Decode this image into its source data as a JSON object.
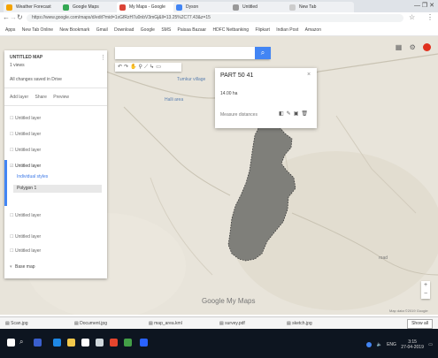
{
  "browser": {
    "tabs": [
      {
        "label": "Weather Forecast"
      },
      {
        "label": "Google Maps"
      },
      {
        "label": "My Maps - Google"
      },
      {
        "label": "Dyson"
      },
      {
        "label": "Untitled"
      },
      {
        "label": "New Tab"
      }
    ],
    "url": "https://www.google.com/maps/d/edit?mid=1xGfRzH7u0nbV3mGj&ll=13.25%2C77.43&z=15",
    "bookmarks": [
      "Apps",
      "New Tab Online",
      "New Bookmark",
      "Gmail",
      "Download",
      "Google",
      "SMS",
      "Paisaa Bazaar",
      "HDFC Netbanking",
      "Flipkart",
      "Indian Post",
      "Amazon"
    ],
    "window_controls": "— ❐ ✕"
  },
  "panel": {
    "title": "UNTITLED MAP",
    "subtitle": "1 views",
    "meta": "All changes saved in Drive",
    "actions": [
      "Add layer",
      "Share",
      "Preview"
    ],
    "layers": [
      {
        "label": "Untitled layer",
        "icon": "layer"
      },
      {
        "label": "Untitled layer",
        "icon": "layer"
      },
      {
        "label": "Untitled layer",
        "icon": "layer"
      },
      {
        "label": "Untitled layer",
        "icon": "layer"
      }
    ],
    "active_layer": {
      "title": "Untitled layer",
      "links": [
        "Individual styles"
      ],
      "selected_item": "Polygon 1"
    },
    "bottom_layers": [
      {
        "label": "Untitled layer"
      },
      {
        "label": "Untitled layer"
      },
      {
        "label": "Untitled layer"
      }
    ],
    "basemap": "Base map"
  },
  "search": {
    "placeholder": ""
  },
  "popup": {
    "title": "PART 50 41",
    "area": "14.00 ha",
    "footer": "Measure distances",
    "action_icons": [
      "style-icon",
      "edit-icon",
      "delete-icon"
    ]
  },
  "map": {
    "labels": [
      "Tumkur village",
      "Halli area",
      "road"
    ],
    "credit": "Map data ©2019 Google",
    "logo": "Google My Maps"
  },
  "downloads": [
    {
      "label": "Scan.jpg"
    },
    {
      "label": "Document.jpg"
    },
    {
      "label": "map_area.kml"
    },
    {
      "label": "survey.pdf"
    },
    {
      "label": "sketch.jpg"
    }
  ],
  "downloads_showall": "Show all",
  "taskbar": {
    "time": "3:15",
    "date": "27-04-2019",
    "lang": "ENG"
  },
  "colors": {
    "polygon": "#7f7f7a",
    "map_bg": "#e7e2d7",
    "accent": "#4285f4"
  }
}
